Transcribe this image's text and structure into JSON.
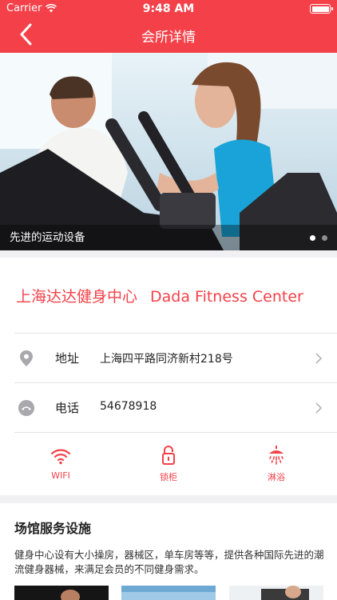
{
  "status_bar": {
    "carrier": "Carrier",
    "time": "9:48 AM"
  },
  "nav": {
    "title": "会所详情",
    "back_icon": "chevron-left-icon"
  },
  "banner": {
    "caption": "先进的运动设备",
    "page_count": 2,
    "active_page": 1
  },
  "club": {
    "name_cn": "上海达达健身中心",
    "name_en": "Dada Fitness Center"
  },
  "info_rows": {
    "address": {
      "icon": "location-pin-icon",
      "label": "地址",
      "value": "上海四平路同济新村218号"
    },
    "phone": {
      "icon": "phone-icon",
      "label": "电话",
      "value": "54678918"
    }
  },
  "amenities": [
    {
      "icon": "wifi-icon",
      "label": "WIFI"
    },
    {
      "icon": "lock-icon",
      "label": "锁柜"
    },
    {
      "icon": "shower-icon",
      "label": "淋浴"
    }
  ],
  "facilities": {
    "title": "场馆服务设施",
    "description": "健身中心设有大小操房，器械区，单车房等等，提供各种国际先进的潮流健身器械，来满足会员的不同健身需求。"
  },
  "colors": {
    "brand": "#f44149",
    "divider": "#e3e3e6",
    "section_bg": "#f1f1f4"
  }
}
